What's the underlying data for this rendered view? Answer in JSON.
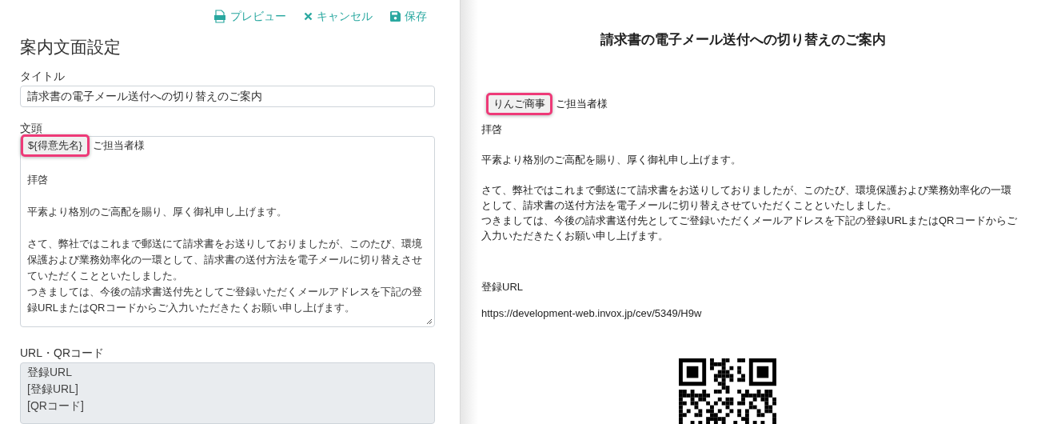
{
  "toolbar": [
    {
      "kind": "pdf",
      "label": "プレビュー"
    },
    {
      "kind": "cancel",
      "label": "キャンセル"
    },
    {
      "kind": "save",
      "label": "保存"
    }
  ],
  "form": {
    "heading": "案内文面設定",
    "title_label": "タイトル",
    "title_value": "請求書の電子メール送付への切り替えのご案内",
    "body_label": "文頭",
    "body": {
      "token": "${得意先名}",
      "token_rest": "ご担当者様",
      "blocks": [
        [
          "拝啓"
        ],
        [
          "平素より格別のご高配を賜り、厚く御礼申し上げます。"
        ],
        [
          "さて、弊社ではこれまで郵送にて請求書をお送りしておりましたが、このたび、環境保護および業務効率化の一環として、請求書の送付方法を電子メールに切り替えさせていただくことといたしました。",
          "つきましては、今後の請求書送付先としてご登録いただくメールアドレスを下記の登録URLまたはQRコードからご入力いただきたくお願い申し上げます。"
        ]
      ]
    },
    "url_label": "URL・QRコード",
    "url_lines": [
      "登録URL",
      "[登録URL]",
      "[QRコード]"
    ]
  },
  "preview": {
    "title": "請求書の電子メール送付への切り替えのご案内",
    "name": "りんご商事",
    "name_rest": "ご担当者様",
    "blocks": [
      [
        "拝啓"
      ],
      [
        "平素より格別のご高配を賜り、厚く御礼申し上げます。"
      ],
      [
        "さて、弊社ではこれまで郵送にて請求書をお送りしておりましたが、このたび、環境保護および業務効率化の一環として、請求書の送付方法を電子メールに切り替えさせていただくことといたしました。",
        "つきましては、今後の請求書送付先としてご登録いただくメールアドレスを下記の登録URLまたはQRコードからご入力いただきたくお願い申し上げます。"
      ]
    ],
    "url_heading": "登録URL",
    "url": "https://development-web.invox.jp/cev/5349/H9w"
  }
}
